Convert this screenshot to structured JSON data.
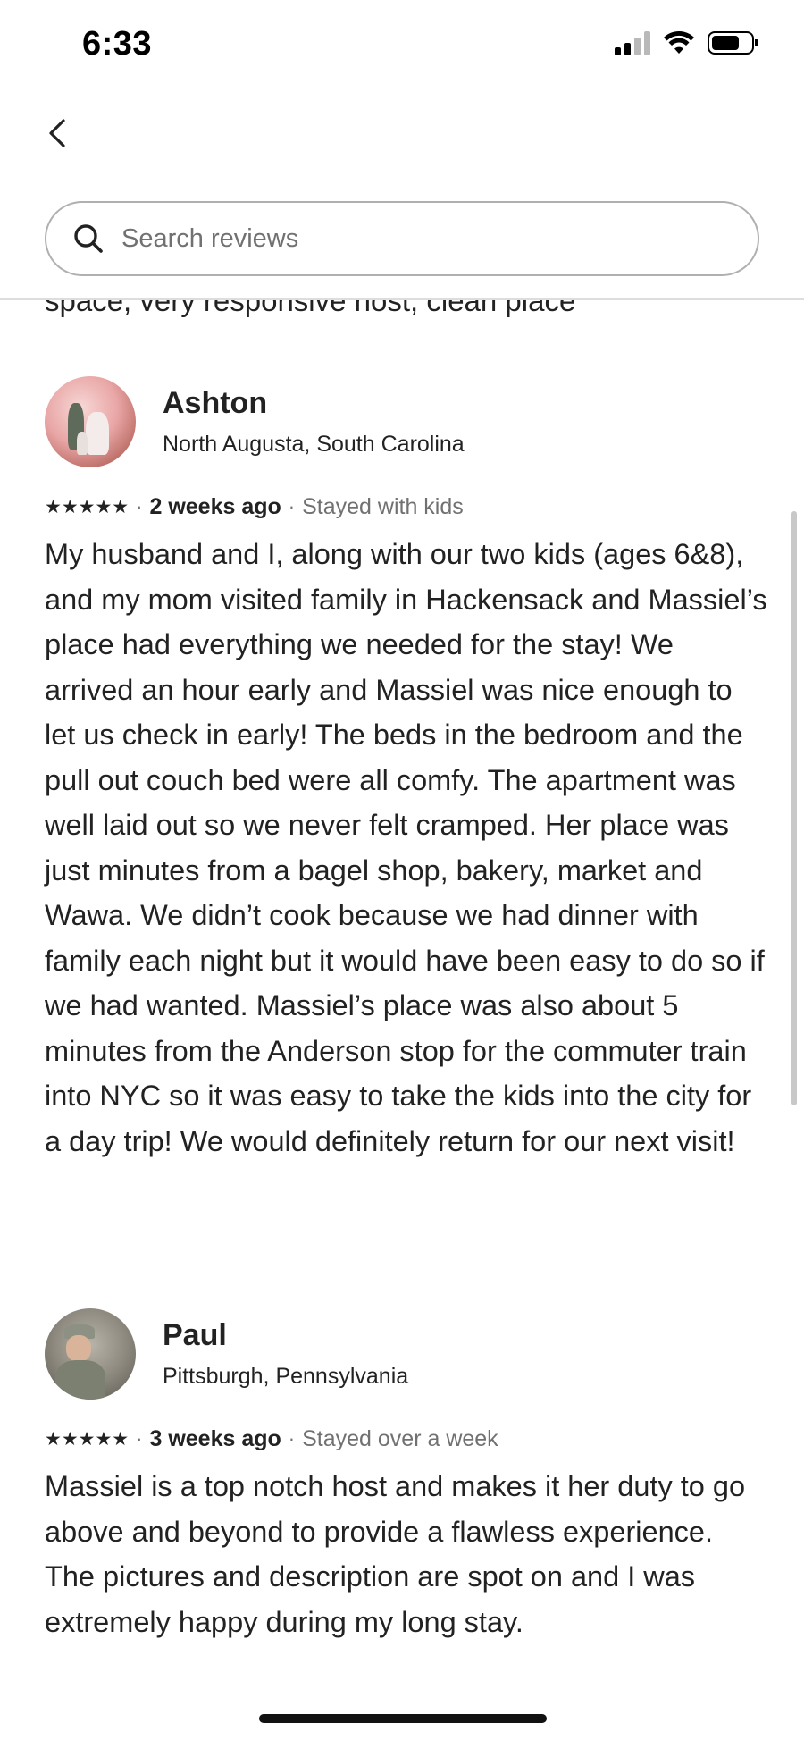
{
  "status_bar": {
    "time": "6:33"
  },
  "header": {
    "back_icon": "chevron-left-icon",
    "search": {
      "placeholder": "Search reviews",
      "value": "",
      "icon": "search-icon"
    }
  },
  "clipped_text": "space, very responsive host, clean place",
  "reviews": [
    {
      "name": "Ashton",
      "location": "North Augusta, South Carolina",
      "stars": "★★★★★",
      "rating": 5,
      "date": "2 weeks ago",
      "stay": "Stayed with kids",
      "text": "My husband and I, along with our two kids (ages 6&8), and my mom visited family in Hackensack and Massiel’s place had everything we needed for the stay! We arrived an hour early and Massiel was nice enough to let us check in early! The beds in the bedroom and the pull out couch bed were all comfy. The apartment was well laid out so we never felt cramped. Her place was just minutes from a bagel shop, bakery, market and Wawa. We didn’t cook because we had dinner with family each night but it would have been easy to do so if we had wanted. Massiel’s place was also about 5 minutes from the Anderson stop for the commuter train into NYC so it was easy to take the kids into the city for a day trip! We would definitely return for our next visit!"
    },
    {
      "name": "Paul",
      "location": "Pittsburgh, Pennsylvania",
      "stars": "★★★★★",
      "rating": 5,
      "date": "3 weeks ago",
      "stay": "Stayed over a week",
      "text": "Massiel is a top notch host and makes it her duty to go above and beyond to provide a flawless experience.   The pictures and description are spot on and I was extremely happy during my long stay."
    }
  ],
  "separator": "·"
}
